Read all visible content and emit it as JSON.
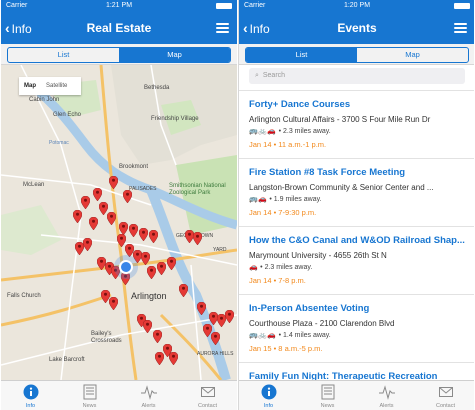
{
  "colors": {
    "brand": "#1776d1",
    "accent_date": "#f2891c",
    "pin": "#e53935"
  },
  "left": {
    "status": {
      "carrier": "Carrier",
      "time": "1:21 PM"
    },
    "nav": {
      "back_label": "Info",
      "title": "Real Estate",
      "menu_icon": "hamburger-icon"
    },
    "segments": [
      {
        "label": "List",
        "active": false
      },
      {
        "label": "Map",
        "active": true
      }
    ],
    "map": {
      "maptype": [
        {
          "label": "Map",
          "active": true
        },
        {
          "label": "Satellite",
          "active": false
        }
      ],
      "labels": {
        "bethesda": "Bethesda",
        "cabin_john": "Cabin John",
        "glen_echo": "Glen Echo",
        "friendship_village": "Friendship Village",
        "brookmont": "Brookmont",
        "mclean": "McLean",
        "smithsonian": "Smithsonian National Zoological Park",
        "falls_church": "Falls Church",
        "arlington": "Arlington",
        "lake_barcroft": "Lake Barcroft",
        "baileys": "Bailey's Crossroads",
        "palisades": "PALISADES",
        "georgetown": "GEORGETOWN",
        "potomac": "Potomac",
        "yard": "YARD",
        "aurora": "AURORA HILLS"
      }
    }
  },
  "right": {
    "status": {
      "carrier": "Carrier",
      "time": "1:20 PM"
    },
    "nav": {
      "back_label": "Info",
      "title": "Events",
      "menu_icon": "hamburger-icon"
    },
    "segments": [
      {
        "label": "List",
        "active": true
      },
      {
        "label": "Map",
        "active": false
      }
    ],
    "search": {
      "placeholder": "Search",
      "icon": "search-icon"
    },
    "events": [
      {
        "title": "Forty+ Dance Courses",
        "location": "Arlington Cultural Affairs - 3700 S Four Mile Run Dr",
        "modes": "🚌🚲🚗",
        "distance": "• 2.3 miles away.",
        "date": "Jan 14 • 11 a.m.-1 p.m."
      },
      {
        "title": "Fire Station #8 Task Force Meeting",
        "location": "Langston-Brown Community & Senior Center and ...",
        "modes": "🚌🚗",
        "distance": "• 1.9 miles away.",
        "date": "Jan 14 • 7-9:30 p.m."
      },
      {
        "title": "How the C&O Canal and W&OD Railroad Shap...",
        "location": "Marymount University - 4655 26th St N",
        "modes": "🚗",
        "distance": "• 2.3 miles away.",
        "date": "Jan 14 • 7-8 p.m."
      },
      {
        "title": "In-Person Absentee Voting",
        "location": "Courthouse Plaza - 2100 Clarendon Blvd",
        "modes": "🚌🚲🚗",
        "distance": "• 1.4 miles away.",
        "date": "Jan 15 • 8 a.m.-5 p.m."
      },
      {
        "title": "Family Fun Night: Therapeutic Recreation",
        "location": "",
        "modes": "",
        "distance": "",
        "date": ""
      }
    ]
  },
  "tabs": [
    {
      "label": "Info",
      "icon": "info-icon",
      "active": true
    },
    {
      "label": "News",
      "icon": "news-icon",
      "active": false
    },
    {
      "label": "Alerts",
      "icon": "alerts-icon",
      "active": false
    },
    {
      "label": "Contact",
      "icon": "contact-icon",
      "active": false
    }
  ]
}
